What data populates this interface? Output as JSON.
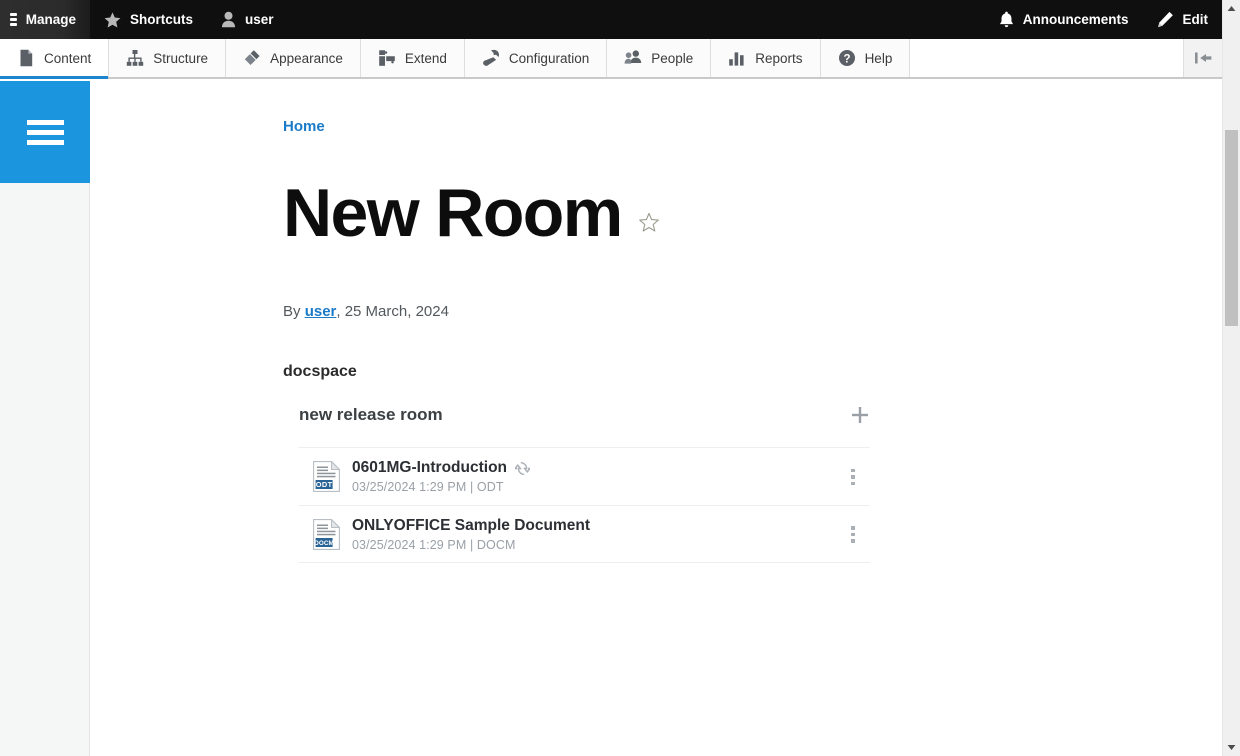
{
  "admin_bar": {
    "items": [
      {
        "label": "Manage",
        "icon": "hamburger-icon",
        "active": true
      },
      {
        "label": "Shortcuts",
        "icon": "star-icon",
        "active": false
      },
      {
        "label": "user",
        "icon": "user-icon",
        "active": false
      }
    ],
    "right_items": [
      {
        "label": "Announcements",
        "icon": "bell-icon"
      },
      {
        "label": "Edit",
        "icon": "pencil-icon"
      }
    ]
  },
  "tab_bar": {
    "tabs": [
      {
        "label": "Content",
        "icon": "page-icon",
        "active": true
      },
      {
        "label": "Structure",
        "icon": "sitemap-icon",
        "active": false
      },
      {
        "label": "Appearance",
        "icon": "brush-icon",
        "active": false
      },
      {
        "label": "Extend",
        "icon": "puzzle-icon",
        "active": false
      },
      {
        "label": "Configuration",
        "icon": "wrench-icon",
        "active": false
      },
      {
        "label": "People",
        "icon": "people-icon",
        "active": false
      },
      {
        "label": "Reports",
        "icon": "bar-chart-icon",
        "active": false
      },
      {
        "label": "Help",
        "icon": "question-mark-icon",
        "active": false
      }
    ],
    "collapse_icon": "collapse-left-icon"
  },
  "left_rail": {
    "toggle_icon": "hamburger-icon",
    "toggle_color": "#1b95dd"
  },
  "content": {
    "breadcrumb": "Home",
    "page_title": "New Room",
    "favorite_icon": "star-outline-icon",
    "byline_prefix": "By ",
    "byline_author": "user",
    "byline_suffix": ", 25 March, 2024",
    "section_label": "docspace"
  },
  "room": {
    "name": "new release room",
    "add_icon": "plus-icon",
    "files": [
      {
        "name": "0601MG-Introduction",
        "modified": "03/25/2024 1:29 PM",
        "separator": " | ",
        "format": "ODT",
        "badge": "ODT",
        "badge_color": "#2a6496",
        "has_sync": true,
        "sync_icon": "sync-icon",
        "menu_icon": "kebab-menu-icon"
      },
      {
        "name": "ONLYOFFICE Sample Document",
        "modified": "03/25/2024 1:29 PM",
        "separator": " | ",
        "format": "DOCM",
        "badge": "DOCM",
        "badge_color": "#2a6496",
        "has_sync": false,
        "sync_icon": "sync-icon",
        "menu_icon": "kebab-menu-icon"
      }
    ]
  },
  "scrollbar": {
    "up_icon": "scroll-up-arrow-icon",
    "down_icon": "scroll-down-arrow-icon",
    "thumb": "scroll-thumb"
  },
  "colors": {
    "accent_blue": "#1b95dd",
    "link_blue": "#1a7bc9",
    "admin_bar": "#0f0f0f"
  }
}
